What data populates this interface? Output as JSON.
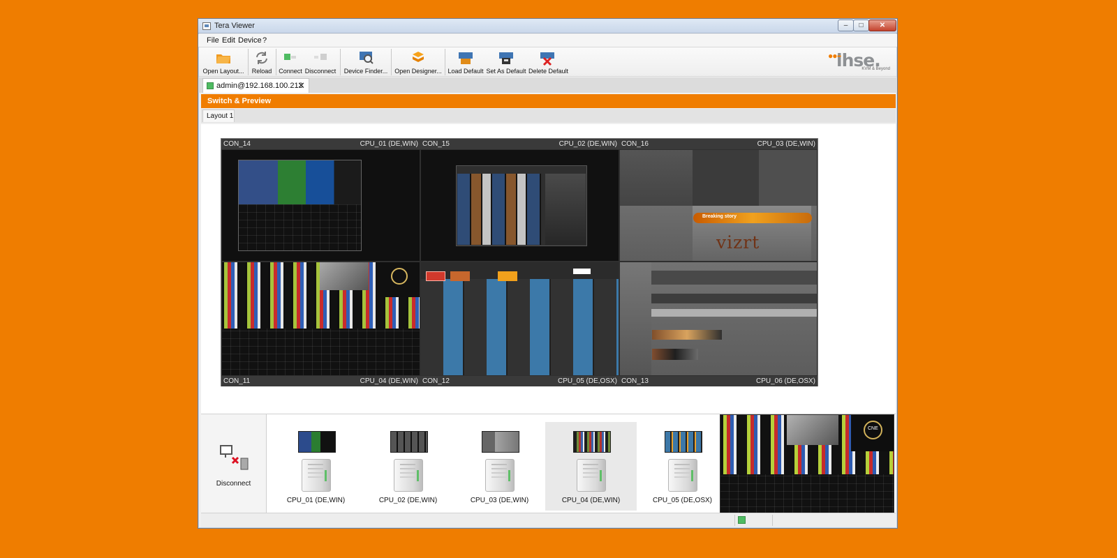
{
  "window": {
    "title": "Tera Viewer",
    "controls": [
      "–",
      "□",
      "✕"
    ]
  },
  "menu": {
    "items": [
      "File",
      "Edit",
      "Device",
      "?"
    ]
  },
  "toolbar": {
    "buttons": [
      {
        "label": "Open Layout...",
        "icon": "folder-open-icon"
      },
      {
        "label": "Reload",
        "icon": "reload-icon"
      },
      {
        "label": "Connect",
        "icon": "connect-icon"
      },
      {
        "label": "Disconnect",
        "icon": "disconnect-icon"
      },
      {
        "label": "Device Finder...",
        "icon": "device-finder-icon"
      },
      {
        "label": "Open Designer...",
        "icon": "designer-icon"
      },
      {
        "label": "Load Default",
        "icon": "load-default-icon"
      },
      {
        "label": "Set As Default",
        "icon": "save-default-icon"
      },
      {
        "label": "Delete Default",
        "icon": "delete-default-icon"
      }
    ]
  },
  "logo": {
    "text": "ihse.",
    "tagline": "KVM & Beyond"
  },
  "session": {
    "tab_label": "admin@192.168.100.213",
    "close": "✕",
    "status_color": "#4fbb62"
  },
  "panel": {
    "title": "Switch & Preview",
    "layout_tab": "Layout 1"
  },
  "video_wall": {
    "top_labels": [
      {
        "con": "CON_14",
        "cpu": "CPU_01 (DE,WIN)"
      },
      {
        "con": "CON_15",
        "cpu": "CPU_02 (DE,WIN)"
      },
      {
        "con": "CON_16",
        "cpu": "CPU_03 (DE,WIN)"
      }
    ],
    "bottom_labels": [
      {
        "con": "CON_11",
        "cpu": "CPU_04 (DE,WIN)"
      },
      {
        "con": "CON_12",
        "cpu": "CPU_05 (DE,OSX)"
      },
      {
        "con": "CON_13",
        "cpu": "CPU_06 (DE,OSX)"
      }
    ],
    "vizrt_text": "vizrt",
    "breaking_text": "Breaking story"
  },
  "bottom_bar": {
    "disconnect_label": "Disconnect",
    "sources": [
      {
        "label": "CPU_01 (DE,WIN)",
        "selected": false
      },
      {
        "label": "CPU_02 (DE,WIN)",
        "selected": false
      },
      {
        "label": "CPU_03 (DE,WIN)",
        "selected": false
      },
      {
        "label": "CPU_04 (DE,WIN)",
        "selected": true
      },
      {
        "label": "CPU_05 (DE,OSX)",
        "selected": false
      }
    ],
    "preview_text": "CNE"
  },
  "status": {
    "indicator_color": "#4fbb62"
  }
}
